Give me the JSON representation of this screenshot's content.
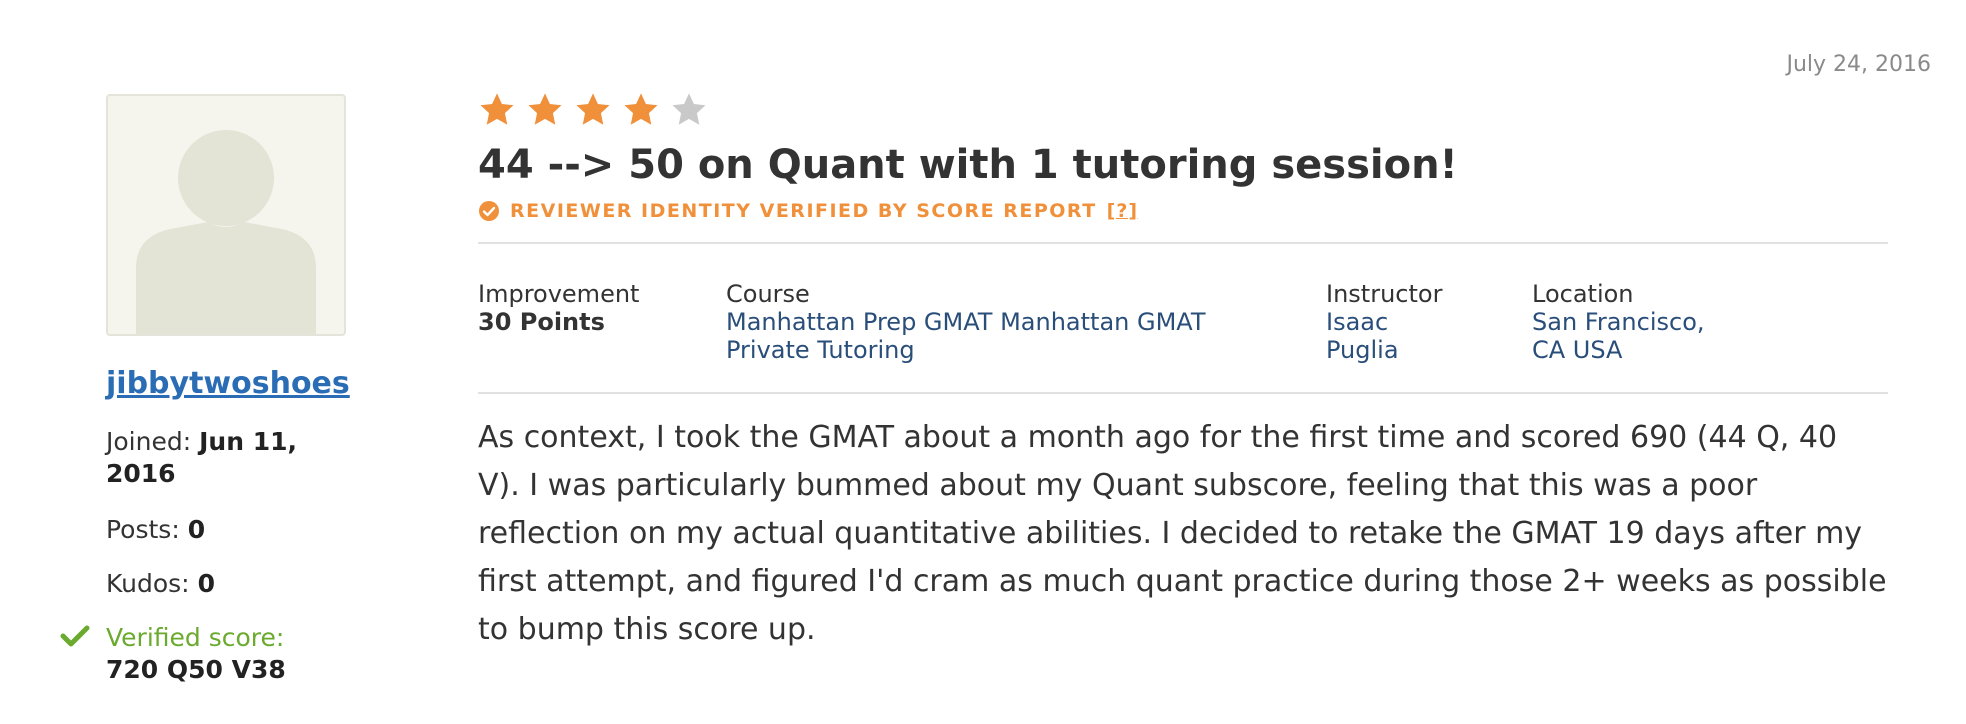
{
  "review": {
    "date": "July 24, 2016",
    "rating": 4,
    "max_rating": 5,
    "title": "44 --> 50 on Quant with 1 tutoring session!",
    "verified_text": "REVIEWER IDENTITY VERIFIED BY SCORE REPORT",
    "verified_help": "[?]",
    "facts": {
      "improvement_label": "Improvement",
      "improvement_value": "30 Points",
      "course_label": "Course",
      "course_value": "Manhattan Prep GMAT Manhattan GMAT Private Tutoring",
      "instructor_label": "Instructor",
      "instructor_value": "Isaac Puglia",
      "location_label": "Location",
      "location_value": "San Francisco, CA USA"
    },
    "body": "As context, I took the GMAT about a month ago for the first time and scored 690 (44 Q, 40 V). I was particularly bummed about my Quant subscore, feeling that this was a poor reflection on my actual quantitative abilities. I decided to retake the GMAT 19 days after my first attempt, and figured I'd cram as much quant practice during those 2+ weeks as possible to bump this score up."
  },
  "reviewer": {
    "username": "jibbytwoshoes",
    "joined_label": "Joined:",
    "joined_value": "Jun 11, 2016",
    "posts_label": "Posts:",
    "posts_value": "0",
    "kudos_label": "Kudos:",
    "kudos_value": "0",
    "verified_label": "Verified score:",
    "verified_value": "720 Q50 V38"
  },
  "colors": {
    "star_on": "#f0903a",
    "star_off": "#c9c9c9",
    "accent": "#f0903a",
    "link": "#2a6db5",
    "verified_green": "#6aaa2e"
  },
  "icons": [
    "avatar-placeholder-icon",
    "star-icon",
    "check-circle-icon",
    "checkmark-icon"
  ]
}
